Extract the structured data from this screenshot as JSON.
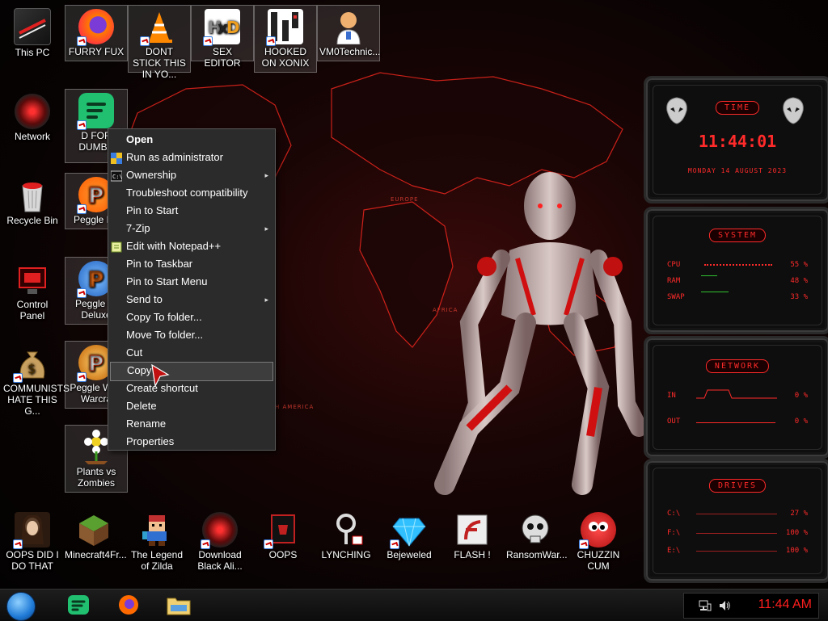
{
  "desktop_icons": {
    "this_pc": "This PC",
    "furry_fux": "FURRY FUX",
    "dont_stick": "DONT STICK THIS IN YO...",
    "sex_editor": "SEX EDITOR",
    "hooked_on_xonix": "HOOKED ON XONIX",
    "vm0technic": "VM0Technic...",
    "network": "Network",
    "d_for_dumba": "D FOR DUMBA",
    "recycle_bin": "Recycle Bin",
    "peggle_de": "Peggle De",
    "control_panel": "Control Panel",
    "peggle_nights": "Peggle Ni Deluxe",
    "communists": "COMMUNISTS HATE THIS G...",
    "peggle_warcraft": "Peggle W of Warcra",
    "plants_vs_zombies": "Plants vs Zombies",
    "oops_did_i": "OOPS DID I DO THAT",
    "minecraft": "Minecraft4Fr...",
    "legend_zilda": "The Legend of Zilda",
    "download_black": "Download Black Ali...",
    "oops": "OOPS",
    "lynching": "LYNCHING",
    "bejeweled": "Bejeweled",
    "flash": "FLASH !",
    "ransomware": "RansomWar...",
    "chuzzin_cum": "CHUZZIN CUM"
  },
  "context_menu": {
    "items": [
      {
        "label": "Open"
      },
      {
        "label": "Run as administrator"
      },
      {
        "label": "Ownership"
      },
      {
        "label": "Troubleshoot compatibility"
      },
      {
        "label": "Pin to Start"
      },
      {
        "label": "7-Zip"
      },
      {
        "label": "Edit with Notepad++"
      },
      {
        "label": "Pin to Taskbar"
      },
      {
        "label": "Pin to Start Menu"
      },
      {
        "label": "Send to"
      },
      {
        "label": "Copy To folder..."
      },
      {
        "label": "Move To folder..."
      },
      {
        "label": "Cut"
      },
      {
        "label": "Copy"
      },
      {
        "label": "Create shortcut"
      },
      {
        "label": "Delete"
      },
      {
        "label": "Rename"
      },
      {
        "label": "Properties"
      }
    ],
    "submenu_arrow": "▸"
  },
  "wallpaper": {
    "labels": [
      "EUROPE",
      "AFRICA",
      "H AMERICA"
    ]
  },
  "gadgets": {
    "time": {
      "title": "TIME",
      "clock": "11:44:01",
      "date": "MONDAY 14 AUGUST 2023"
    },
    "system": {
      "title": "SYSTEM",
      "rows": [
        {
          "label": "CPU",
          "value": "55 %",
          "level": 0.55
        },
        {
          "label": "RAM",
          "value": "48 %",
          "level": 0.48
        },
        {
          "label": "SWAP",
          "value": "33 %",
          "level": 0.33
        }
      ]
    },
    "network": {
      "title": "NETWORK",
      "rows": [
        {
          "label": "IN",
          "value": "0 %"
        },
        {
          "label": "OUT",
          "value": "0 %"
        }
      ]
    },
    "drives": {
      "title": "DRIVES",
      "rows": [
        {
          "label": "C:\\",
          "value": "27 %"
        },
        {
          "label": "F:\\",
          "value": "100 %"
        },
        {
          "label": "E:\\",
          "value": "100 %"
        }
      ]
    }
  },
  "taskbar": {
    "clock": "11:44 AM"
  },
  "colors": {
    "accent": "#ff2a2a",
    "menu_bg": "#2b2b2b"
  }
}
